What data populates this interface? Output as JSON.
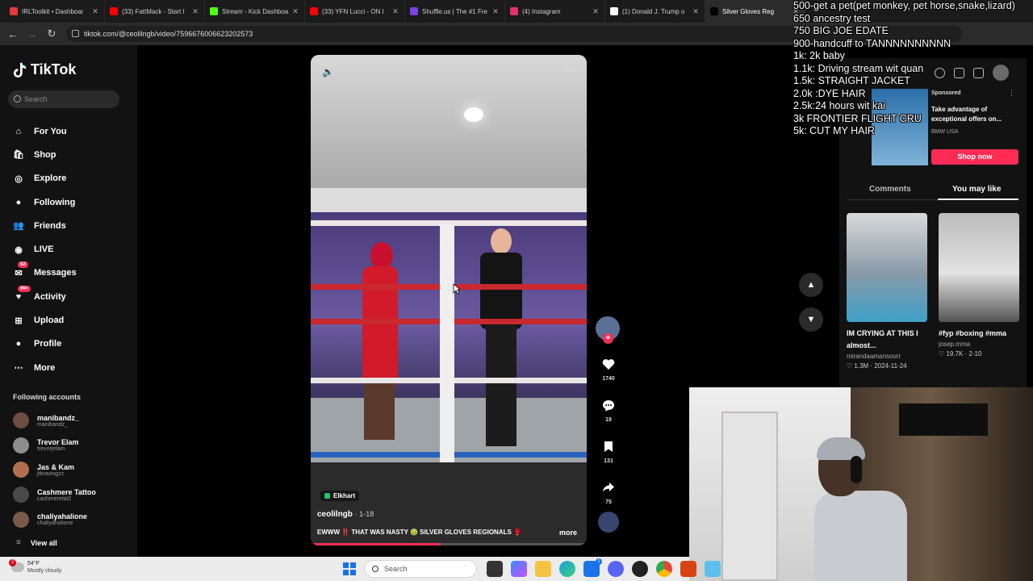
{
  "browser": {
    "tabs": [
      {
        "title": "IRLToolkit • Dashboar",
        "color": "#e53935"
      },
      {
        "title": "(33) FattMack - Start l",
        "color": "#ff0000"
      },
      {
        "title": "Stream - Kick Dashboa",
        "color": "#53fc18"
      },
      {
        "title": "(33) YFN Lucci - ON l",
        "color": "#ff0000"
      },
      {
        "title": "Shuffle.us | The #1 Fre",
        "color": "#7b3fe4"
      },
      {
        "title": "(4) Instagram",
        "color": "#e1306c"
      },
      {
        "title": "(1) Donald J. Trump o",
        "color": "#ffffff"
      },
      {
        "title": "Silver Gloves Reg",
        "color": "#000000"
      }
    ],
    "url": "tiktok.com/@ceolilngb/video/7596676006623202573"
  },
  "sidebar": {
    "logo": "TikTok",
    "search_placeholder": "Search",
    "nav": [
      {
        "label": "For You",
        "icon": "home-icon"
      },
      {
        "label": "Shop",
        "icon": "shop-icon"
      },
      {
        "label": "Explore",
        "icon": "compass-icon"
      },
      {
        "label": "Following",
        "icon": "following-icon"
      },
      {
        "label": "Friends",
        "icon": "friends-icon"
      },
      {
        "label": "LIVE",
        "icon": "live-icon"
      },
      {
        "label": "Messages",
        "icon": "messages-icon",
        "badge": "62"
      },
      {
        "label": "Activity",
        "icon": "activity-icon",
        "badge": "99+"
      },
      {
        "label": "Upload",
        "icon": "upload-icon"
      },
      {
        "label": "Profile",
        "icon": "profile-icon"
      },
      {
        "label": "More",
        "icon": "more-icon"
      }
    ],
    "following_title": "Following accounts",
    "accounts": [
      {
        "name": "manibandz_",
        "handle": "manibandz_"
      },
      {
        "name": "Trevor Elam",
        "handle": "trevorjelam"
      },
      {
        "name": "Jas & Kam",
        "handle": "jtkravingzz"
      },
      {
        "name": "Cashmere Tattoo",
        "handle": "cashmeretat2"
      },
      {
        "name": "chaliyahalione",
        "handle": "chaliyahalione"
      }
    ],
    "view_all": "View all"
  },
  "video": {
    "location_tag": "Elkhart",
    "author": "ceolilngb",
    "date": "· 1-18",
    "caption": "EWWW ‼️ THAT WAS NASTY 🤢 SILVER GLOVES REGIONALS 🥊",
    "more": "more",
    "progress": 0.47,
    "likes": "1740",
    "comments": "19",
    "saves": "131",
    "shares": "75"
  },
  "right_panel": {
    "ad": {
      "sponsored": "Sponsored",
      "title": "Take advantage of exceptional offers on...",
      "brand": "BMW USA",
      "cta": "Shop now"
    },
    "tabs": [
      "Comments",
      "You may like"
    ],
    "active_tab": "You may like",
    "cards": [
      {
        "title": "IM CRYING AT THIS I almost...",
        "user": "mirandaamansourr",
        "stat": "1.3M · 2024-11-24"
      },
      {
        "title": "#fyp #boxing #mma",
        "user": "josep.mma",
        "stat": "19.7K · 2-10"
      }
    ]
  },
  "overlay": {
    "lines": [
      "500-get a pet(pet monkey, pet horse,snake,lizard)",
      "650 ancestry test",
      "750 BIG JOE EDATE",
      "900-handcuff to TANNNNNNNNNN",
      "1k: 2k baby",
      "1.1k: Driving stream wit quan",
      "1.5k: STRAIGHT JACKET",
      "2.0k :DYE HAIR",
      "2.5k:24 hours wit kai",
      "3k FRONTIER FLIGHT CRU",
      "5k: CUT MY HAIR"
    ]
  },
  "taskbar": {
    "weather_badge": "2",
    "temp": "54°F",
    "weather_desc": "Mostly cloudy",
    "search_placeholder": "Search",
    "badge_count": "1"
  }
}
